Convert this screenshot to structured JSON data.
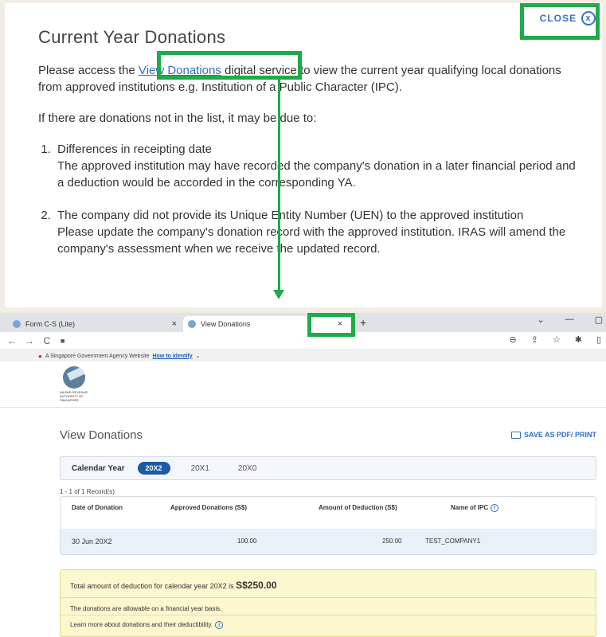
{
  "modal": {
    "title": "Current Year Donations",
    "close_label": "CLOSE",
    "close_glyph": "x",
    "para1_before": "Please access the ",
    "para1_link": "View Donations",
    "para1_after": " digital service to view the current year qualifying local donations from approved institutions e.g. Institution of a Public Character (IPC).",
    "para2": "If there are donations not in the list, it may be due to:",
    "reasons": [
      {
        "title": "Differences in receipting date",
        "detail": "The approved institution may have recorded the company's donation in a later financial period and a deduction would be accorded in the corresponding YA."
      },
      {
        "title": "The company did not provide its Unique Entity Number (UEN) to the approved institution",
        "detail": "Please update the company's donation record with the approved institution. IRAS will amend the company's assessment when we receive the updated record."
      }
    ]
  },
  "browser": {
    "tabs": [
      {
        "label": "Form C-S (Lite)",
        "close": "×"
      },
      {
        "label": "View Donations",
        "close": "×"
      }
    ],
    "new_tab": "+",
    "win_minimize": "—",
    "win_restore": "▢",
    "nav_back": "←",
    "nav_forward": "→",
    "nav_reload": "C",
    "lock": "🔒",
    "gov_banner": "A Singapore Government Agency Website",
    "gov_how": "How to identify",
    "gov_chevron": "⌄",
    "logo_text": "INLAND REVENUE AUTHORITY OF SINGAPORE"
  },
  "page": {
    "title": "View Donations",
    "save_label": "SAVE AS PDF/ PRINT",
    "calendar_year_label": "Calendar Year",
    "years": [
      "20X2",
      "20X1",
      "20X0"
    ],
    "selected_year": "20X2",
    "record_count": "1 - 1 of 1 Record(s)",
    "table": {
      "headers": [
        "Date of Donation",
        "Approved Donations (S$)",
        "Amount of Deduction (S$)",
        "Name of IPC"
      ],
      "rows": [
        [
          "30 Jun 20X2",
          "100.00",
          "250.00",
          "TEST_COMPANY1"
        ]
      ]
    },
    "summary": {
      "total_text": "Total amount of deduction for calendar year 20X2 is ",
      "total_amount": "S$250.00",
      "line2": "The donations are allowable on a financial year basis.",
      "line3": "Learn more about donations and their deductibility."
    }
  },
  "annotation": {
    "color": "#1cad48"
  }
}
